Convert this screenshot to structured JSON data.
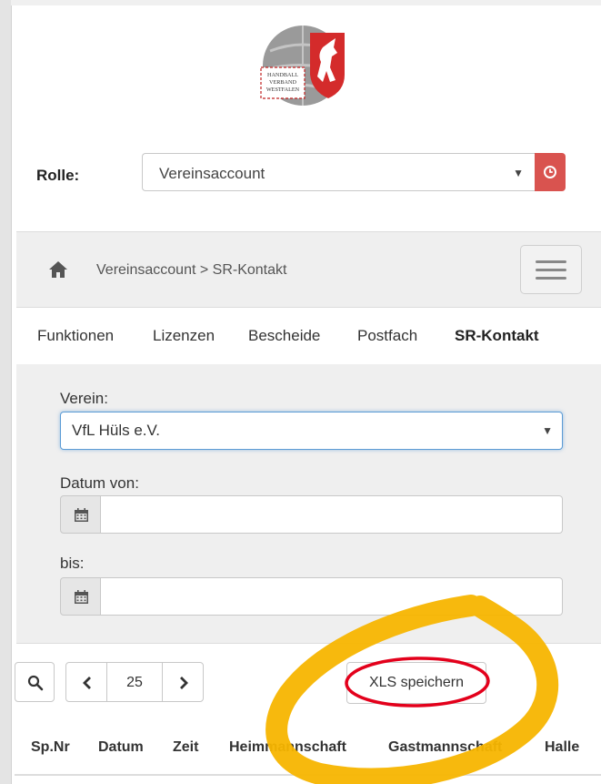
{
  "logo": {
    "text_lines": [
      "HANDBALL",
      "VERBAND",
      "WESTFALEN"
    ]
  },
  "role": {
    "label": "Rolle:",
    "selected": "Vereinsaccount",
    "caret": "▼",
    "button_icon": "clock-icon",
    "button_color": "#d9534f"
  },
  "breadcrumb": {
    "home_icon": "home-icon",
    "text": "Vereinsaccount > SR-Kontakt",
    "menu_icon": "hamburger-icon"
  },
  "tabs": [
    {
      "label": "Funktionen",
      "active": false
    },
    {
      "label": "Lizenzen",
      "active": false
    },
    {
      "label": "Bescheide",
      "active": false
    },
    {
      "label": "Postfach",
      "active": false
    },
    {
      "label": "SR-Kontakt",
      "active": true
    }
  ],
  "filter": {
    "verein_label": "Verein:",
    "verein_value": "VfL Hüls e.V.",
    "caret": "▼",
    "datum_von_label": "Datum von:",
    "datum_von_value": "",
    "bis_label": "bis:",
    "bis_value": "",
    "calendar_icon": "calendar-icon"
  },
  "pager": {
    "search_icon": "search-icon",
    "prev_icon": "chevron-left-icon",
    "page_size": "25",
    "next_icon": "chevron-right-icon"
  },
  "export": {
    "label": "XLS speichern"
  },
  "table": {
    "headers": [
      "Sp.Nr",
      "Datum",
      "Zeit",
      "Heimmannschaft",
      "Gastmannschaft",
      "Halle"
    ]
  },
  "annotation_colors": {
    "highlighter": "#f7b500",
    "circle": "#e3001b"
  }
}
